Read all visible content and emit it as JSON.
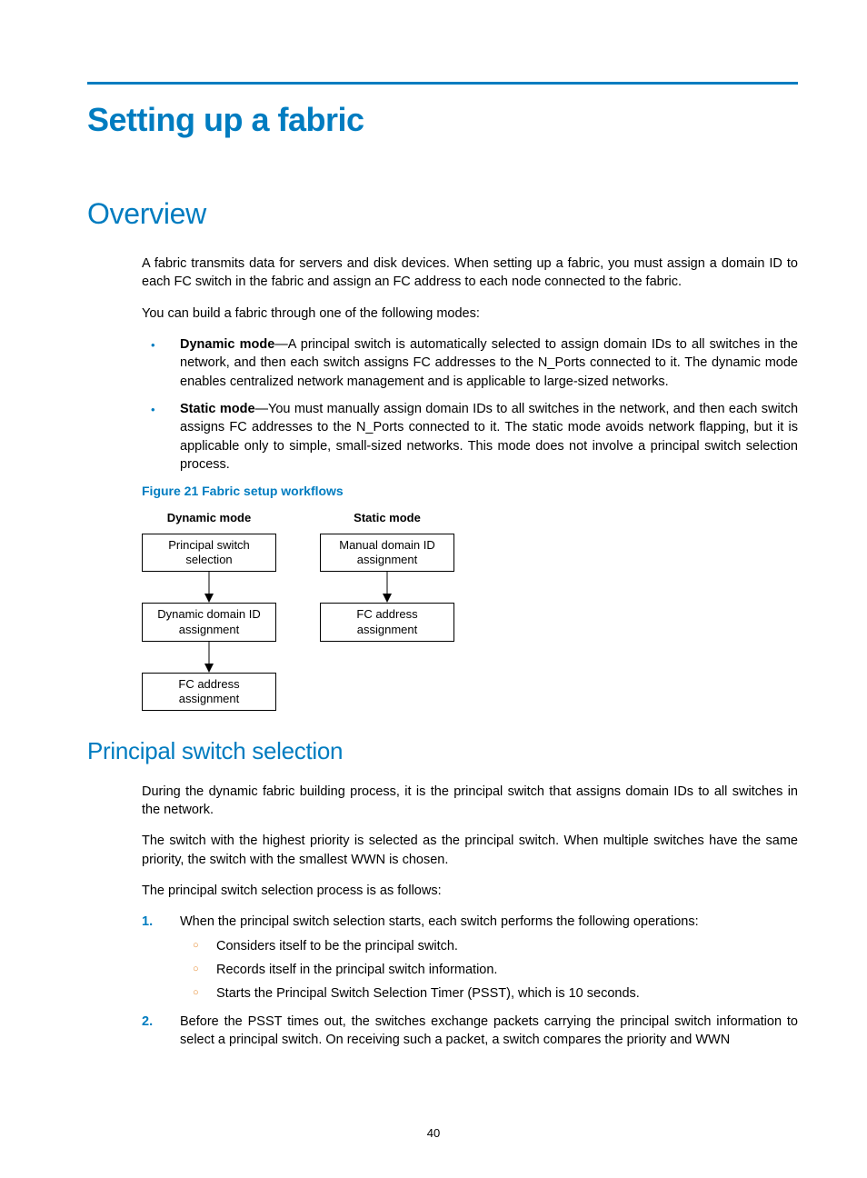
{
  "chapterTitle": "Setting up a fabric",
  "section1": {
    "title": "Overview",
    "p1": "A fabric transmits data for servers and disk devices. When setting up a fabric, you must assign a domain ID to each FC switch in the fabric and assign an FC address to each node connected to the fabric.",
    "p2": "You can build a fabric through one of the following modes:",
    "bullets": [
      {
        "term": "Dynamic mode",
        "text": "—A principal switch is automatically selected to assign domain IDs to all switches in the network, and then each switch assigns FC addresses to the N_Ports connected to it. The dynamic mode enables centralized network management and is applicable to large-sized networks."
      },
      {
        "term": "Static mode",
        "text": "—You must manually assign domain IDs to all switches in the network, and then each switch assigns FC addresses to the N_Ports connected to it. The static mode avoids network flapping, but it is applicable only to simple, small-sized networks. This mode does not involve a principal switch selection process."
      }
    ],
    "figure": {
      "caption": "Figure 21 Fabric setup workflows",
      "cols": [
        {
          "head": "Dynamic mode",
          "boxes": [
            "Principal switch selection",
            "Dynamic domain ID assignment",
            "FC address assignment"
          ]
        },
        {
          "head": "Static mode",
          "boxes": [
            "Manual domain ID assignment",
            "FC address assignment"
          ]
        }
      ]
    }
  },
  "section2": {
    "title": "Principal switch selection",
    "p1": "During the dynamic fabric building process, it is the principal switch that assigns domain IDs to all switches in the network.",
    "p2": "The switch with the highest priority is selected as the principal switch. When multiple switches have the same priority, the switch with the smallest WWN is chosen.",
    "p3": "The principal switch selection process is as follows:",
    "list": [
      {
        "num": "1.",
        "text": "When the principal switch selection starts, each switch performs the following operations:",
        "sub": [
          "Considers itself to be the principal switch.",
          "Records itself in the principal switch information.",
          "Starts the Principal Switch Selection Timer (PSST), which is 10 seconds."
        ]
      },
      {
        "num": "2.",
        "text": "Before the PSST times out, the switches exchange packets carrying the principal switch information to select a principal switch. On receiving such a packet, a switch compares the priority and WWN"
      }
    ]
  },
  "pageNumber": "40"
}
